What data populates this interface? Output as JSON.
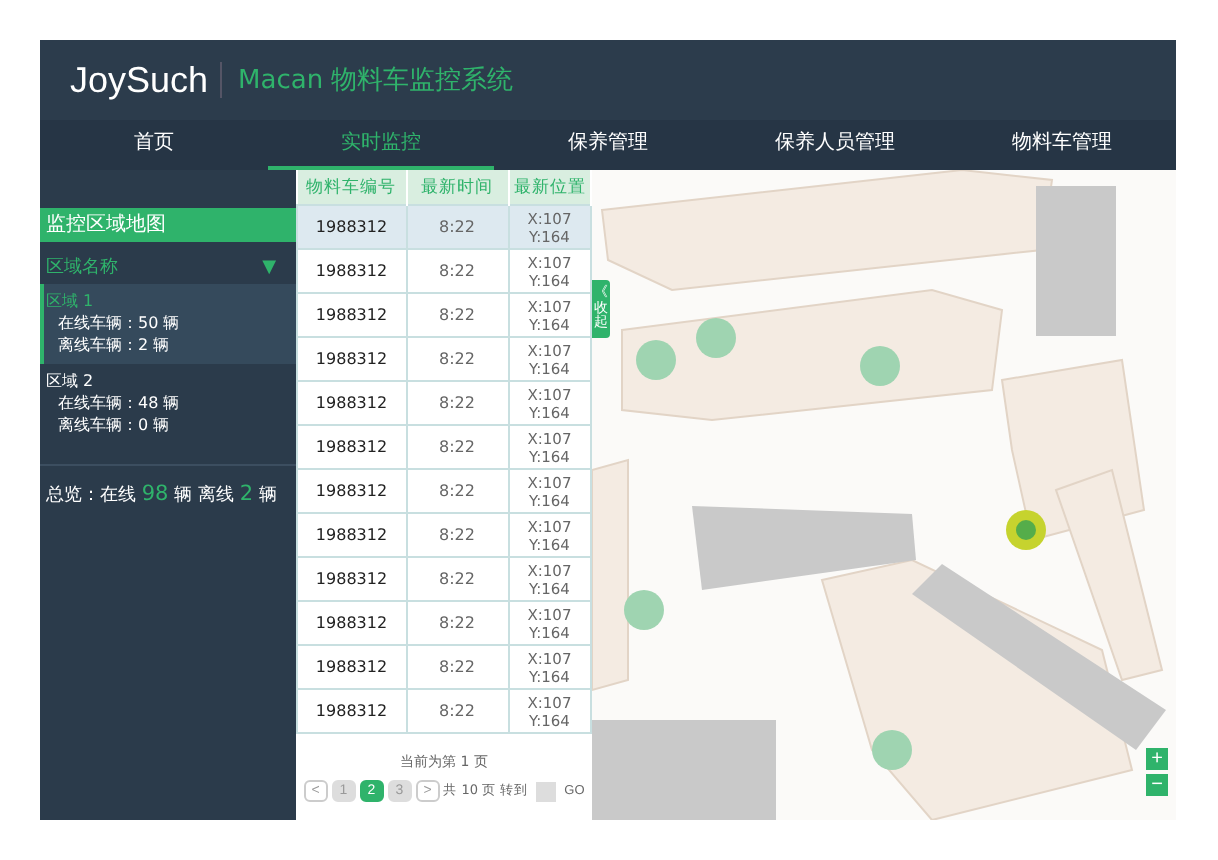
{
  "header": {
    "brand": "JoySuch",
    "system_title": "Macan 物料车监控系统"
  },
  "nav": [
    {
      "label": "首页",
      "selected": false
    },
    {
      "label": "实时监控",
      "selected": true
    },
    {
      "label": "保养管理",
      "selected": false
    },
    {
      "label": "保养人员管理",
      "selected": false
    },
    {
      "label": "物料车管理",
      "selected": false
    }
  ],
  "sidebar": {
    "title": "监控区域地图",
    "area_header": "区域名称",
    "caret": "▼",
    "areas": [
      {
        "name": "区域 1",
        "online": "在线车辆：50 辆",
        "offline": "离线车辆：2 辆",
        "selected": true
      },
      {
        "name": "区域 2",
        "online": "在线车辆：48 辆",
        "offline": "离线车辆：0 辆",
        "selected": false
      }
    ],
    "summary": [
      {
        "text": "总览：在线 ",
        "highlight": false
      },
      {
        "text": "98",
        "highlight": true
      },
      {
        "text": " 辆  离线 ",
        "highlight": false
      },
      {
        "text": "2",
        "highlight": true
      },
      {
        "text": " 辆",
        "highlight": false
      }
    ]
  },
  "table": {
    "columns": [
      "物料车编号",
      "最新时间",
      "最新位置"
    ],
    "rows": [
      {
        "id": "1988312",
        "time": "8:22",
        "x": "X:107",
        "y": "Y:164",
        "selected": true
      },
      {
        "id": "1988312",
        "time": "8:22",
        "x": "X:107",
        "y": "Y:164",
        "selected": false
      },
      {
        "id": "1988312",
        "time": "8:22",
        "x": "X:107",
        "y": "Y:164",
        "selected": false
      },
      {
        "id": "1988312",
        "time": "8:22",
        "x": "X:107",
        "y": "Y:164",
        "selected": false
      },
      {
        "id": "1988312",
        "time": "8:22",
        "x": "X:107",
        "y": "Y:164",
        "selected": false
      },
      {
        "id": "1988312",
        "time": "8:22",
        "x": "X:107",
        "y": "Y:164",
        "selected": false
      },
      {
        "id": "1988312",
        "time": "8:22",
        "x": "X:107",
        "y": "Y:164",
        "selected": false
      },
      {
        "id": "1988312",
        "time": "8:22",
        "x": "X:107",
        "y": "Y:164",
        "selected": false
      },
      {
        "id": "1988312",
        "time": "8:22",
        "x": "X:107",
        "y": "Y:164",
        "selected": false
      },
      {
        "id": "1988312",
        "time": "8:22",
        "x": "X:107",
        "y": "Y:164",
        "selected": false
      },
      {
        "id": "1988312",
        "time": "8:22",
        "x": "X:107",
        "y": "Y:164",
        "selected": false
      },
      {
        "id": "1988312",
        "time": "8:22",
        "x": "X:107",
        "y": "Y:164",
        "selected": false
      }
    ]
  },
  "pagination": {
    "current_text": "当前为第 1 页",
    "prev": "<",
    "pages": [
      {
        "label": "1",
        "selected": false
      },
      {
        "label": "2",
        "selected": true
      },
      {
        "label": "3",
        "selected": false
      }
    ],
    "next": ">",
    "total": "共 10 页",
    "goto_label": "转到",
    "go": "GO"
  },
  "map": {
    "kind": "picture",
    "collapse_tab": {
      "icon": "《",
      "label": "收起"
    },
    "zoom_in": "+",
    "zoom_out": "−"
  }
}
